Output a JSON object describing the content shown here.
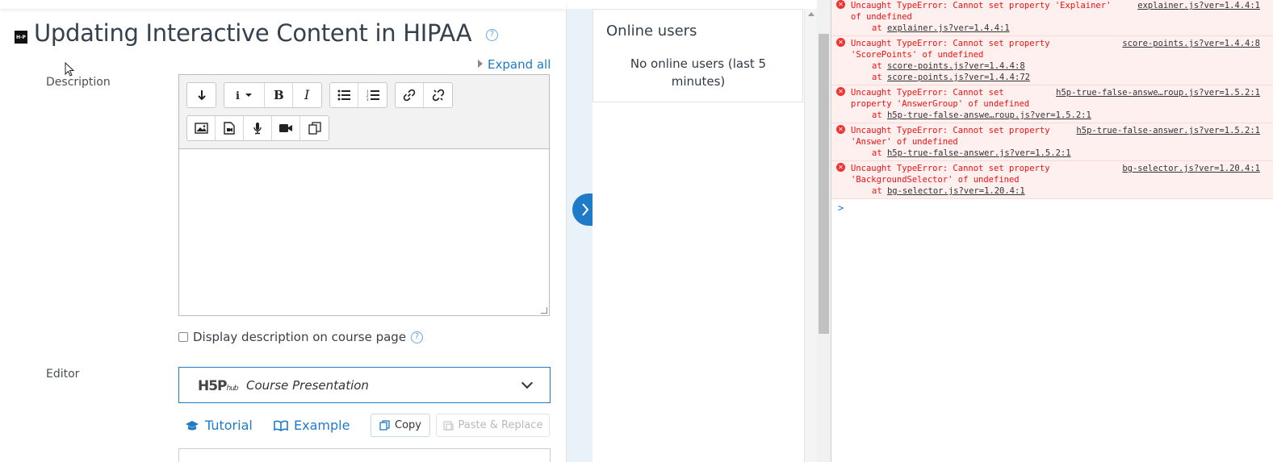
{
  "page": {
    "title": "Updating Interactive Content in HIPAA",
    "logo_text": "H-P",
    "expand_all": "Expand all",
    "description_label": "Description",
    "editor_label": "Editor",
    "display_description": "Display description on course page",
    "hub": {
      "logo_text": "H5P",
      "logo_suffix": "hub",
      "content_type": "Course Presentation"
    },
    "tutorial_label": "Tutorial",
    "example_label": "Example",
    "copy_label": "Copy",
    "paste_label": "Paste & Replace"
  },
  "sidebar": {
    "online_users_title": "Online users",
    "online_users_body": "No online users (last 5 minutes)"
  },
  "console": {
    "errors": [
      {
        "message": "Uncaught TypeError: Cannot set property 'Explainer'\nof undefined",
        "source": "explainer.js?ver=1.4.4:1",
        "stack": [
          "explainer.js?ver=1.4.4:1"
        ]
      },
      {
        "message": "Uncaught TypeError: Cannot set property\n'ScorePoints' of undefined",
        "source": "score-points.js?ver=1.4.4:8",
        "stack": [
          "score-points.js?ver=1.4.4:8",
          "score-points.js?ver=1.4.4:72"
        ]
      },
      {
        "message": "Uncaught TypeError: Cannot set\nproperty 'AnswerGroup' of undefined",
        "source": "h5p-true-false-answe…roup.js?ver=1.5.2:1",
        "stack": [
          "h5p-true-false-answe…roup.js?ver=1.5.2:1"
        ]
      },
      {
        "message": "Uncaught TypeError: Cannot set property\n'Answer' of undefined",
        "source": "h5p-true-false-answer.js?ver=1.5.2:1",
        "stack": [
          "h5p-true-false-answer.js?ver=1.5.2:1"
        ]
      },
      {
        "message": "Uncaught TypeError: Cannot set property\n'BackgroundSelector' of undefined",
        "source": "bg-selector.js?ver=1.20.4:1",
        "stack": [
          "bg-selector.js?ver=1.20.4:1"
        ]
      }
    ],
    "at_prefix": "at",
    "prompt_symbol": ">"
  },
  "colors": {
    "link": "#1f7ac8",
    "error_text": "#e11111",
    "error_bg": "#fff0f0"
  }
}
